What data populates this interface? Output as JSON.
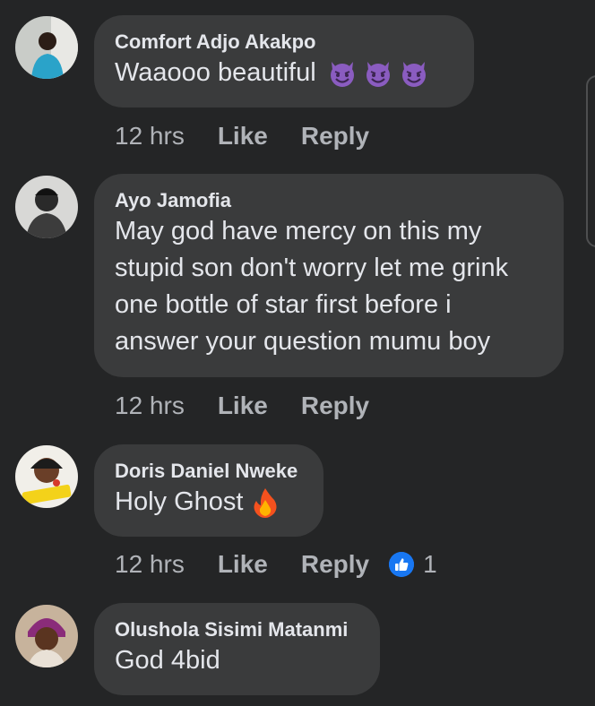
{
  "comments": [
    {
      "author": "Comfort Adjo Akakpo",
      "text": "Waaooo beautiful",
      "emoji": [
        "smiling-devil",
        "smiling-devil",
        "smiling-devil"
      ],
      "time": "12 hrs",
      "like_label": "Like",
      "reply_label": "Reply"
    },
    {
      "author": "Ayo Jamofia",
      "lines": [
        "May god have mercy on this my",
        "stupid son don't worry let me grink",
        "one bottle of star first before i",
        "answer your question mumu boy"
      ],
      "time": "12 hrs",
      "like_label": "Like",
      "reply_label": "Reply"
    },
    {
      "author": "Doris Daniel Nweke",
      "text": "Holy Ghost",
      "emoji": [
        "fire"
      ],
      "time": "12 hrs",
      "like_label": "Like",
      "reply_label": "Reply",
      "reaction_count": "1"
    },
    {
      "author": "Olushola Sisimi Matanmi",
      "text": "God 4bid"
    }
  ],
  "colors": {
    "background": "#242526",
    "bubble": "#3a3b3c",
    "primary_text": "#e4e6eb",
    "secondary_text": "#b0b3b8",
    "like_blue": "#1877f2"
  }
}
